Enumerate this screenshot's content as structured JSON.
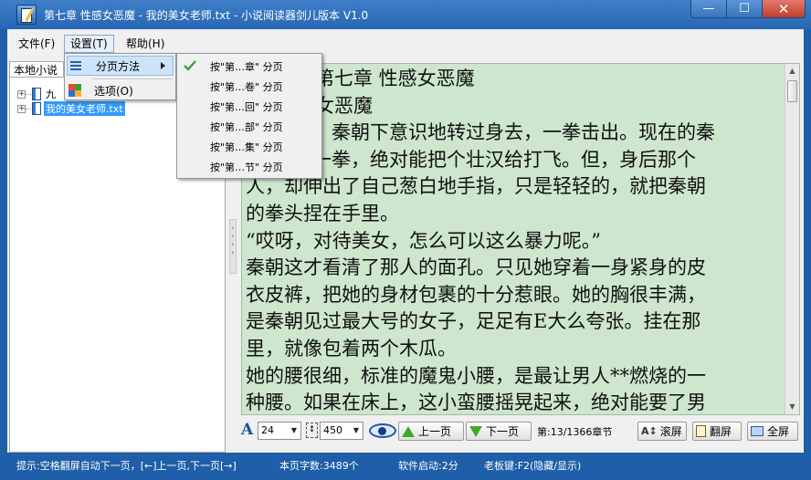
{
  "window": {
    "title": "第七章 性感女恶魔 - 我的美女老师.txt - 小说阅读器剑儿版本  V1.0",
    "controls": {
      "minimize": "—",
      "maximize": "☐",
      "close": "✕"
    }
  },
  "menubar": {
    "file": "文件(F)",
    "settings": "设置(T)",
    "help": "帮助(H)"
  },
  "settings_menu": {
    "items": [
      {
        "label": "分页方法",
        "icon": "list-icon",
        "has_submenu": true,
        "highlighted": true
      },
      {
        "label": "选项(O)",
        "icon": "grid-icon",
        "has_submenu": false,
        "highlighted": false
      }
    ]
  },
  "split_submenu": {
    "items": [
      {
        "label": "按\"第…章\" 分页",
        "checked": true
      },
      {
        "label": "按\"第…卷\" 分页",
        "checked": false
      },
      {
        "label": "按\"第…回\" 分页",
        "checked": false
      },
      {
        "label": "按\"第…部\" 分页",
        "checked": false
      },
      {
        "label": "按\"第…集\" 分页",
        "checked": false
      },
      {
        "label": "按\"第…节\" 分页",
        "checked": false
      }
    ]
  },
  "left_panel": {
    "tab_label": "本地小说",
    "tree": [
      {
        "label": "九",
        "expander": "+",
        "selected": false
      },
      {
        "label": "我的美女老师.txt",
        "expander": "+",
        "selected": true
      }
    ]
  },
  "reader": {
    "lines": [
      "第七章 性感女恶魔",
      "女恶魔",
      "　　秦朝下意识地转过身去，一拳击出。现在的秦",
      "朝一拳，绝对能把个壮汉给打飞。但，身后那个",
      "人，却伸出了自己葱白地手指，只是轻轻的，就把秦朝",
      "的拳头捏在手里。",
      "“哎呀，对待美女，怎么可以这么暴力呢。”",
      "秦朝这才看清了那人的面孔。只见她穿着一身紧身的皮",
      "衣皮裤，把她的身材包裹的十分惹眼。她的胸很丰满，",
      "是秦朝见过最大号的女子，足足有E大么夸张。挂在那",
      "里，就像包着两个木瓜。",
      "她的腰很细，标准的魔鬼小腰，是最让男人**燃烧的一",
      "种腰。如果在床上，这小蛮腰摇晃起来，绝对能要了男"
    ]
  },
  "toolbar": {
    "font_size": "24",
    "page_width": "450",
    "prev_label": "上一页",
    "next_label": "下一页",
    "progress": "第:13/1366章节",
    "scroll_label": "滚屏",
    "page_label": "翻屏",
    "full_label": "全屏"
  },
  "statusbar": {
    "hint": "提示:空格翻屏自动下一页，[←]上一页,下一页[→]",
    "word_count": "本页字数:3489个",
    "uptime": "软件启动:2分",
    "boss_key": "老板键:F2(隐藏/显示)"
  },
  "colors": {
    "title_bar": "#2766b3",
    "reader_bg": "#cde6cd",
    "selection": "#3399ff",
    "status_bar": "#1f5ea8"
  }
}
